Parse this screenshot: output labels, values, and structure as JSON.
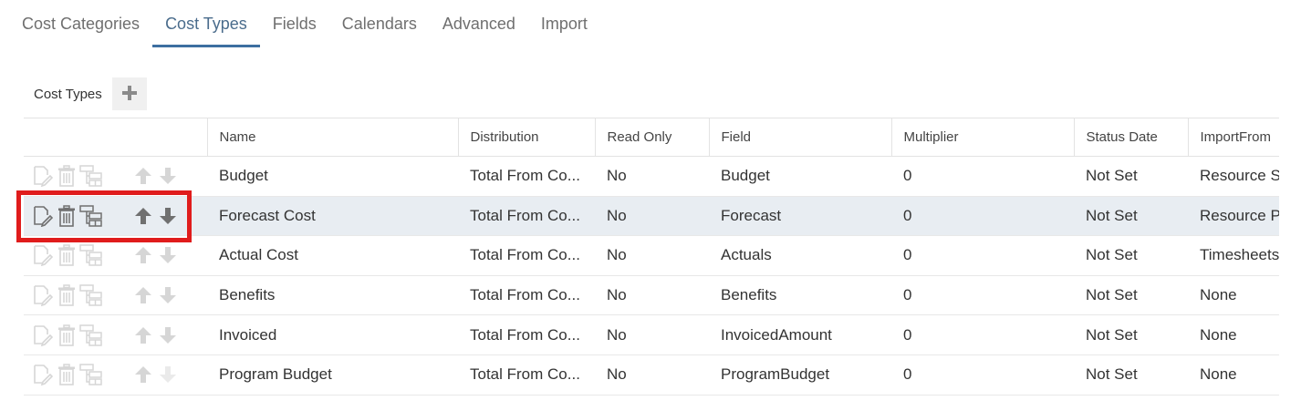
{
  "tabs": [
    {
      "label": "Cost Categories",
      "active": false
    },
    {
      "label": "Cost Types",
      "active": true
    },
    {
      "label": "Fields",
      "active": false
    },
    {
      "label": "Calendars",
      "active": false
    },
    {
      "label": "Advanced",
      "active": false
    },
    {
      "label": "Import",
      "active": false
    }
  ],
  "section": {
    "title": "Cost Types",
    "add_icon": "plus-icon"
  },
  "table": {
    "columns": [
      "",
      "Name",
      "Distribution",
      "Read Only",
      "Field",
      "Multiplier",
      "Status Date",
      "ImportFrom"
    ],
    "row_action_icons": [
      "edit-icon",
      "trash-icon",
      "hierarchy-icon",
      "arrow-up-icon",
      "arrow-down-icon"
    ],
    "rows": [
      {
        "name": "Budget",
        "distribution": "Total From Co...",
        "read_only": "No",
        "field": "Budget",
        "multiplier": "0",
        "status_date": "Not Set",
        "import_from": "Resource So"
      },
      {
        "name": "Forecast Cost",
        "distribution": "Total From Co...",
        "read_only": "No",
        "field": "Forecast",
        "multiplier": "0",
        "status_date": "Not Set",
        "import_from": "Resource Pl"
      },
      {
        "name": "Actual Cost",
        "distribution": "Total From Co...",
        "read_only": "No",
        "field": "Actuals",
        "multiplier": "0",
        "status_date": "Not Set",
        "import_from": "Timesheets"
      },
      {
        "name": "Benefits",
        "distribution": "Total From Co...",
        "read_only": "No",
        "field": "Benefits",
        "multiplier": "0",
        "status_date": "Not Set",
        "import_from": "None"
      },
      {
        "name": "Invoiced",
        "distribution": "Total From Co...",
        "read_only": "No",
        "field": "InvoicedAmount",
        "multiplier": "0",
        "status_date": "Not Set",
        "import_from": "None"
      },
      {
        "name": "Program Budget",
        "distribution": "Total From Co...",
        "read_only": "No",
        "field": "ProgramBudget",
        "multiplier": "0",
        "status_date": "Not Set",
        "import_from": "None"
      }
    ]
  },
  "colors": {
    "accent": "#3d6fa0",
    "selected_row": "#e8edf2",
    "highlight": "#e01c1c",
    "icon": "#707070"
  }
}
